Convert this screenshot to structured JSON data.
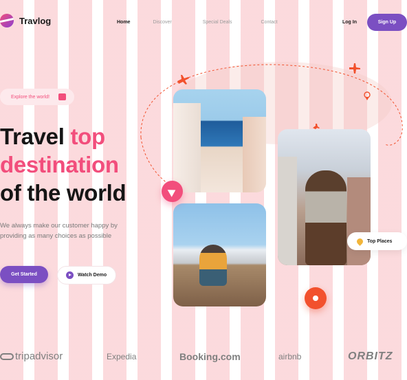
{
  "brand": {
    "name": "Travlog",
    "primary_color": "#7b4fc2",
    "accent_color": "#f24e7c"
  },
  "nav": {
    "items": [
      "Home",
      "Discover",
      "Special Deals",
      "Contact"
    ]
  },
  "auth": {
    "login": "Log In",
    "signup": "Sign Up"
  },
  "hero": {
    "badge": "Explore the world!",
    "title_line1_a": "Travel ",
    "title_line1_b": "top",
    "title_line2": "destination",
    "title_line3": "of the world",
    "description": "We always make our customer happy by providing as many choices as possible",
    "cta_primary": "Get Started",
    "cta_secondary": "Watch Demo"
  },
  "tags": {
    "top_places": "Top Places"
  },
  "partners": [
    "tripadvisor",
    "Expedia",
    "Booking.com",
    "airbnb",
    "ORBITZ"
  ],
  "icons": [
    "airplane-icon",
    "pin-icon",
    "send-icon",
    "add-user-icon",
    "play-icon",
    "bag-icon"
  ]
}
